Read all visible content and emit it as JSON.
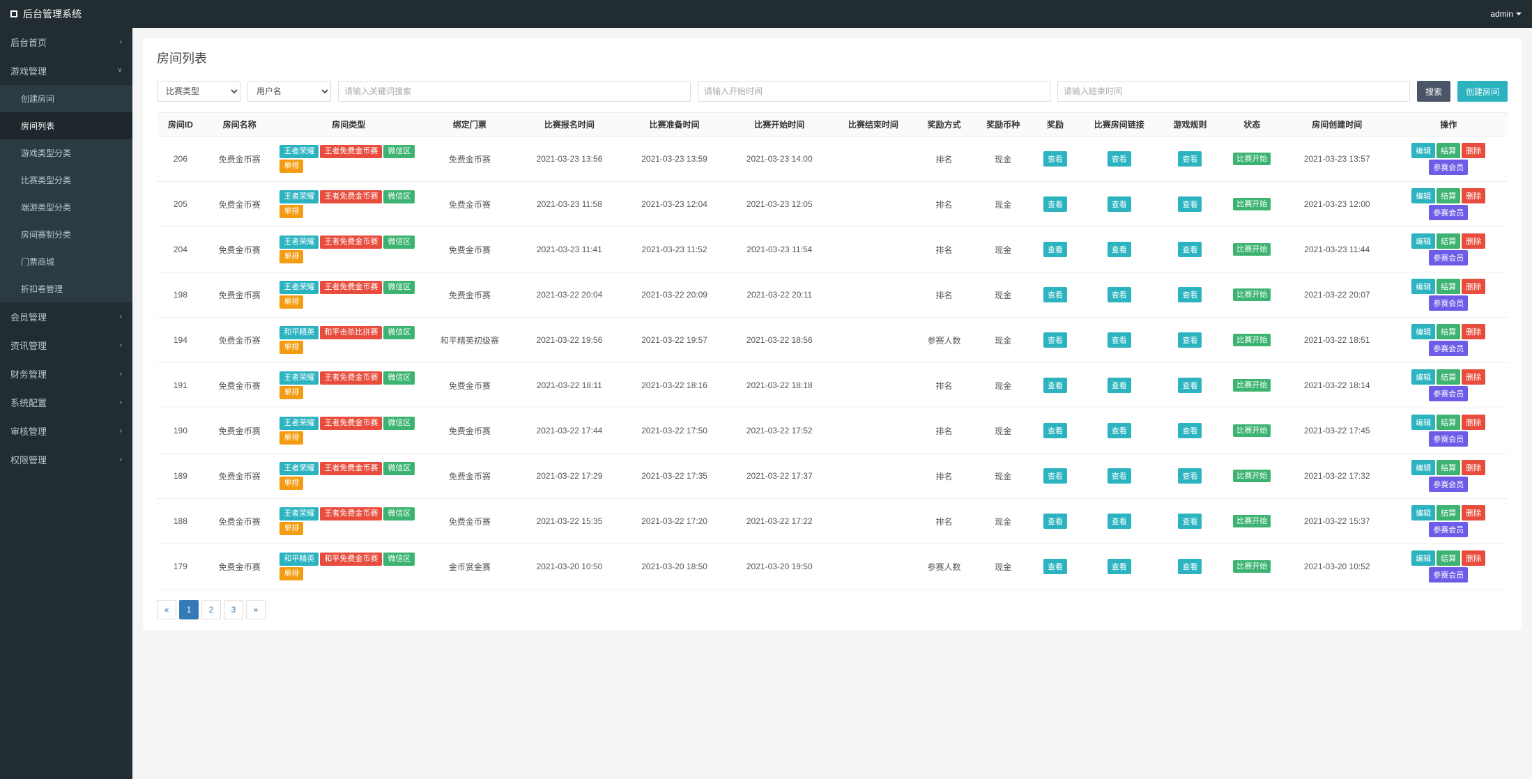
{
  "topbar": {
    "title": "后台管理系统",
    "user": "admin"
  },
  "sidebar": {
    "items": [
      {
        "label": "后台首页",
        "chevron": ">"
      },
      {
        "label": "游戏管理",
        "chevron": "v",
        "expanded": true,
        "sub": [
          "创建房间",
          "房间列表",
          "游戏类型分类",
          "比赛类型分类",
          "端游类型分类",
          "房间赛制分类",
          "门票商城",
          "折扣卷管理"
        ]
      },
      {
        "label": "会员管理",
        "chevron": ">"
      },
      {
        "label": "资讯管理",
        "chevron": ">"
      },
      {
        "label": "财务管理",
        "chevron": ">"
      },
      {
        "label": "系统配置",
        "chevron": ">"
      },
      {
        "label": "审核管理",
        "chevron": ">"
      },
      {
        "label": "权限管理",
        "chevron": ">"
      }
    ],
    "active_sub": "房间列表"
  },
  "page": {
    "title": "房间列表"
  },
  "filters": {
    "type_placeholder": "比赛类型",
    "user_placeholder": "用户名",
    "keyword_placeholder": "请输入关键词搜索",
    "start_placeholder": "请输入开始时间",
    "end_placeholder": "请输入结束时间",
    "search_label": "搜索",
    "create_label": "创建房间"
  },
  "table": {
    "headers": [
      "房间ID",
      "房间名称",
      "房间类型",
      "绑定门票",
      "比赛报名时间",
      "比赛准备时间",
      "比赛开始时间",
      "比赛结束时间",
      "奖励方式",
      "奖励币种",
      "奖励",
      "比赛房间链接",
      "游戏规则",
      "状态",
      "房间创建时间",
      "操作"
    ],
    "view_label": "查看",
    "status_label": "比赛开始",
    "action_labels": {
      "edit": "编辑",
      "settle": "结算",
      "delete": "删除",
      "member": "参赛会员"
    },
    "rows": [
      {
        "id": "206",
        "name": "免费金币赛",
        "types": [
          [
            "王者荣耀",
            "cyan"
          ],
          [
            "王者免费金币赛",
            "red"
          ],
          [
            "微信区",
            "green"
          ],
          [
            "单排",
            "orange"
          ]
        ],
        "ticket": "免费金币赛",
        "t1": "2021-03-23 13:56",
        "t2": "2021-03-23 13:59",
        "t3": "2021-03-23 14:00",
        "t4": "",
        "reward_mode": "排名",
        "currency": "现金",
        "created": "2021-03-23 13:57"
      },
      {
        "id": "205",
        "name": "免费金币赛",
        "types": [
          [
            "王者荣耀",
            "cyan"
          ],
          [
            "王者免费金币赛",
            "red"
          ],
          [
            "微信区",
            "green"
          ],
          [
            "单排",
            "orange"
          ]
        ],
        "ticket": "免费金币赛",
        "t1": "2021-03-23 11:58",
        "t2": "2021-03-23 12:04",
        "t3": "2021-03-23 12:05",
        "t4": "",
        "reward_mode": "排名",
        "currency": "现金",
        "created": "2021-03-23 12:00"
      },
      {
        "id": "204",
        "name": "免费金币赛",
        "types": [
          [
            "王者荣耀",
            "cyan"
          ],
          [
            "王者免费金币赛",
            "red"
          ],
          [
            "微信区",
            "green"
          ],
          [
            "单排",
            "orange"
          ]
        ],
        "ticket": "免费金币赛",
        "t1": "2021-03-23 11:41",
        "t2": "2021-03-23 11:52",
        "t3": "2021-03-23 11:54",
        "t4": "",
        "reward_mode": "排名",
        "currency": "现金",
        "created": "2021-03-23 11:44"
      },
      {
        "id": "198",
        "name": "免费金币赛",
        "types": [
          [
            "王者荣耀",
            "cyan"
          ],
          [
            "王者免费金币赛",
            "red"
          ],
          [
            "微信区",
            "green"
          ],
          [
            "单排",
            "orange"
          ]
        ],
        "ticket": "免费金币赛",
        "t1": "2021-03-22 20:04",
        "t2": "2021-03-22 20:09",
        "t3": "2021-03-22 20:11",
        "t4": "",
        "reward_mode": "排名",
        "currency": "现金",
        "created": "2021-03-22 20:07"
      },
      {
        "id": "194",
        "name": "免费金币赛",
        "types": [
          [
            "和平精英",
            "cyan"
          ],
          [
            "和平击杀比拼赛",
            "red"
          ],
          [
            "微信区",
            "green"
          ],
          [
            "单排",
            "orange"
          ]
        ],
        "ticket": "和平精英初级赛",
        "t1": "2021-03-22 19:56",
        "t2": "2021-03-22 19:57",
        "t3": "2021-03-22 18:56",
        "t4": "",
        "reward_mode": "参赛人数",
        "currency": "现金",
        "created": "2021-03-22 18:51"
      },
      {
        "id": "191",
        "name": "免费金币赛",
        "types": [
          [
            "王者荣耀",
            "cyan"
          ],
          [
            "王者免费金币赛",
            "red"
          ],
          [
            "微信区",
            "green"
          ],
          [
            "单排",
            "orange"
          ]
        ],
        "ticket": "免费金币赛",
        "t1": "2021-03-22 18:11",
        "t2": "2021-03-22 18:16",
        "t3": "2021-03-22 18:18",
        "t4": "",
        "reward_mode": "排名",
        "currency": "现金",
        "created": "2021-03-22 18:14"
      },
      {
        "id": "190",
        "name": "免费金币赛",
        "types": [
          [
            "王者荣耀",
            "cyan"
          ],
          [
            "王者免费金币赛",
            "red"
          ],
          [
            "微信区",
            "green"
          ],
          [
            "单排",
            "orange"
          ]
        ],
        "ticket": "免费金币赛",
        "t1": "2021-03-22 17:44",
        "t2": "2021-03-22 17:50",
        "t3": "2021-03-22 17:52",
        "t4": "",
        "reward_mode": "排名",
        "currency": "现金",
        "created": "2021-03-22 17:45"
      },
      {
        "id": "189",
        "name": "免费金币赛",
        "types": [
          [
            "王者荣耀",
            "cyan"
          ],
          [
            "王者免费金币赛",
            "red"
          ],
          [
            "微信区",
            "green"
          ],
          [
            "单排",
            "orange"
          ]
        ],
        "ticket": "免费金币赛",
        "t1": "2021-03-22 17:29",
        "t2": "2021-03-22 17:35",
        "t3": "2021-03-22 17:37",
        "t4": "",
        "reward_mode": "排名",
        "currency": "现金",
        "created": "2021-03-22 17:32"
      },
      {
        "id": "188",
        "name": "免费金币赛",
        "types": [
          [
            "王者荣耀",
            "cyan"
          ],
          [
            "王者免费金币赛",
            "red"
          ],
          [
            "微信区",
            "green"
          ],
          [
            "单排",
            "orange"
          ]
        ],
        "ticket": "免费金币赛",
        "t1": "2021-03-22 15:35",
        "t2": "2021-03-22 17:20",
        "t3": "2021-03-22 17:22",
        "t4": "",
        "reward_mode": "排名",
        "currency": "现金",
        "created": "2021-03-22 15:37"
      },
      {
        "id": "179",
        "name": "免费金币赛",
        "types": [
          [
            "和平精英",
            "cyan"
          ],
          [
            "和平免费金币赛",
            "red"
          ],
          [
            "微信区",
            "green"
          ],
          [
            "单排",
            "orange"
          ]
        ],
        "ticket": "金币赏金赛",
        "t1": "2021-03-20 10:50",
        "t2": "2021-03-20 18:50",
        "t3": "2021-03-20 19:50",
        "t4": "",
        "reward_mode": "参赛人数",
        "currency": "现金",
        "created": "2021-03-20 10:52"
      }
    ]
  },
  "pagination": {
    "prev": "«",
    "next": "»",
    "pages": [
      "1",
      "2",
      "3"
    ],
    "active": "1"
  }
}
